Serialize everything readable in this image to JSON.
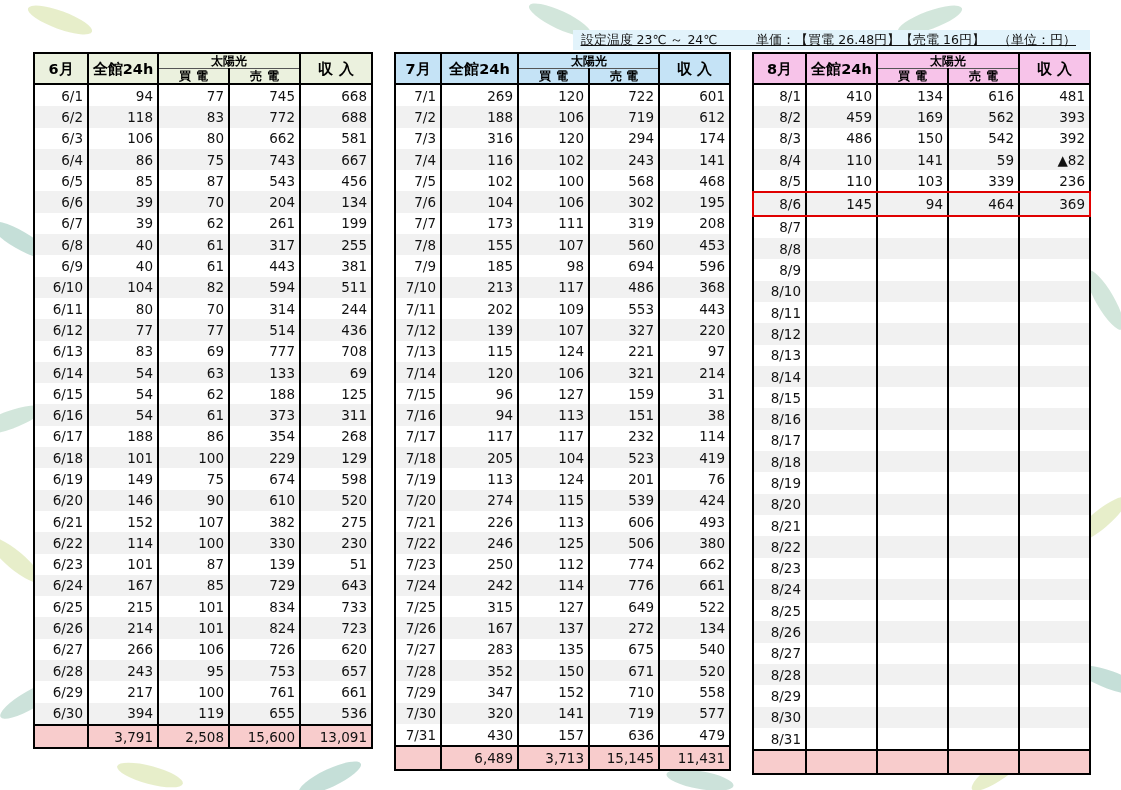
{
  "note": "設定温度 23℃ ～ 24℃　　　単価：【買電 26.48円】【売電 16円】　（単位：円）",
  "tables": [
    {
      "color": "#ebf1de",
      "headers": {
        "month": "6月",
        "total": "全館24h",
        "solar": "太陽光",
        "buy": "買 電",
        "sell": "売 電",
        "income": "収 入"
      },
      "rows": [
        {
          "date": "6/1",
          "values": [
            "94",
            "77",
            "745",
            "668"
          ],
          "highlighted": false
        },
        {
          "date": "6/2",
          "values": [
            "118",
            "83",
            "772",
            "688"
          ],
          "highlighted": false
        },
        {
          "date": "6/3",
          "values": [
            "106",
            "80",
            "662",
            "581"
          ],
          "highlighted": false
        },
        {
          "date": "6/4",
          "values": [
            "86",
            "75",
            "743",
            "667"
          ],
          "highlighted": false
        },
        {
          "date": "6/5",
          "values": [
            "85",
            "87",
            "543",
            "456"
          ],
          "highlighted": false
        },
        {
          "date": "6/6",
          "values": [
            "39",
            "70",
            "204",
            "134"
          ],
          "highlighted": false
        },
        {
          "date": "6/7",
          "values": [
            "39",
            "62",
            "261",
            "199"
          ],
          "highlighted": false
        },
        {
          "date": "6/8",
          "values": [
            "40",
            "61",
            "317",
            "255"
          ],
          "highlighted": false
        },
        {
          "date": "6/9",
          "values": [
            "40",
            "61",
            "443",
            "381"
          ],
          "highlighted": false
        },
        {
          "date": "6/10",
          "values": [
            "104",
            "82",
            "594",
            "511"
          ],
          "highlighted": false
        },
        {
          "date": "6/11",
          "values": [
            "80",
            "70",
            "314",
            "244"
          ],
          "highlighted": false
        },
        {
          "date": "6/12",
          "values": [
            "77",
            "77",
            "514",
            "436"
          ],
          "highlighted": false
        },
        {
          "date": "6/13",
          "values": [
            "83",
            "69",
            "777",
            "708"
          ],
          "highlighted": false
        },
        {
          "date": "6/14",
          "values": [
            "54",
            "63",
            "133",
            "69"
          ],
          "highlighted": false
        },
        {
          "date": "6/15",
          "values": [
            "54",
            "62",
            "188",
            "125"
          ],
          "highlighted": false
        },
        {
          "date": "6/16",
          "values": [
            "54",
            "61",
            "373",
            "311"
          ],
          "highlighted": false
        },
        {
          "date": "6/17",
          "values": [
            "188",
            "86",
            "354",
            "268"
          ],
          "highlighted": false
        },
        {
          "date": "6/18",
          "values": [
            "101",
            "100",
            "229",
            "129"
          ],
          "highlighted": false
        },
        {
          "date": "6/19",
          "values": [
            "149",
            "75",
            "674",
            "598"
          ],
          "highlighted": false
        },
        {
          "date": "6/20",
          "values": [
            "146",
            "90",
            "610",
            "520"
          ],
          "highlighted": false
        },
        {
          "date": "6/21",
          "values": [
            "152",
            "107",
            "382",
            "275"
          ],
          "highlighted": false
        },
        {
          "date": "6/22",
          "values": [
            "114",
            "100",
            "330",
            "230"
          ],
          "highlighted": false
        },
        {
          "date": "6/23",
          "values": [
            "101",
            "87",
            "139",
            "51"
          ],
          "highlighted": false
        },
        {
          "date": "6/24",
          "values": [
            "167",
            "85",
            "729",
            "643"
          ],
          "highlighted": false
        },
        {
          "date": "6/25",
          "values": [
            "215",
            "101",
            "834",
            "733"
          ],
          "highlighted": false
        },
        {
          "date": "6/26",
          "values": [
            "214",
            "101",
            "824",
            "723"
          ],
          "highlighted": false
        },
        {
          "date": "6/27",
          "values": [
            "266",
            "106",
            "726",
            "620"
          ],
          "highlighted": false
        },
        {
          "date": "6/28",
          "values": [
            "243",
            "95",
            "753",
            "657"
          ],
          "highlighted": false
        },
        {
          "date": "6/29",
          "values": [
            "217",
            "100",
            "761",
            "661"
          ],
          "highlighted": false
        },
        {
          "date": "6/30",
          "values": [
            "394",
            "119",
            "655",
            "536"
          ],
          "highlighted": false
        }
      ],
      "totals": [
        "3,791",
        "2,508",
        "15,600",
        "13,091"
      ]
    },
    {
      "color": "#c5e3f6",
      "headers": {
        "month": "7月",
        "total": "全館24h",
        "solar": "太陽光",
        "buy": "買 電",
        "sell": "売 電",
        "income": "収 入"
      },
      "rows": [
        {
          "date": "7/1",
          "values": [
            "269",
            "120",
            "722",
            "601"
          ],
          "highlighted": false
        },
        {
          "date": "7/2",
          "values": [
            "188",
            "106",
            "719",
            "612"
          ],
          "highlighted": false
        },
        {
          "date": "7/3",
          "values": [
            "316",
            "120",
            "294",
            "174"
          ],
          "highlighted": false
        },
        {
          "date": "7/4",
          "values": [
            "116",
            "102",
            "243",
            "141"
          ],
          "highlighted": false
        },
        {
          "date": "7/5",
          "values": [
            "102",
            "100",
            "568",
            "468"
          ],
          "highlighted": false
        },
        {
          "date": "7/6",
          "values": [
            "104",
            "106",
            "302",
            "195"
          ],
          "highlighted": false
        },
        {
          "date": "7/7",
          "values": [
            "173",
            "111",
            "319",
            "208"
          ],
          "highlighted": false
        },
        {
          "date": "7/8",
          "values": [
            "155",
            "107",
            "560",
            "453"
          ],
          "highlighted": false
        },
        {
          "date": "7/9",
          "values": [
            "185",
            "98",
            "694",
            "596"
          ],
          "highlighted": false
        },
        {
          "date": "7/10",
          "values": [
            "213",
            "117",
            "486",
            "368"
          ],
          "highlighted": false
        },
        {
          "date": "7/11",
          "values": [
            "202",
            "109",
            "553",
            "443"
          ],
          "highlighted": false
        },
        {
          "date": "7/12",
          "values": [
            "139",
            "107",
            "327",
            "220"
          ],
          "highlighted": false
        },
        {
          "date": "7/13",
          "values": [
            "115",
            "124",
            "221",
            "97"
          ],
          "highlighted": false
        },
        {
          "date": "7/14",
          "values": [
            "120",
            "106",
            "321",
            "214"
          ],
          "highlighted": false
        },
        {
          "date": "7/15",
          "values": [
            "96",
            "127",
            "159",
            "31"
          ],
          "highlighted": false
        },
        {
          "date": "7/16",
          "values": [
            "94",
            "113",
            "151",
            "38"
          ],
          "highlighted": false
        },
        {
          "date": "7/17",
          "values": [
            "117",
            "117",
            "232",
            "114"
          ],
          "highlighted": false
        },
        {
          "date": "7/18",
          "values": [
            "205",
            "104",
            "523",
            "419"
          ],
          "highlighted": false
        },
        {
          "date": "7/19",
          "values": [
            "113",
            "124",
            "201",
            "76"
          ],
          "highlighted": false
        },
        {
          "date": "7/20",
          "values": [
            "274",
            "115",
            "539",
            "424"
          ],
          "highlighted": false
        },
        {
          "date": "7/21",
          "values": [
            "226",
            "113",
            "606",
            "493"
          ],
          "highlighted": false
        },
        {
          "date": "7/22",
          "values": [
            "246",
            "125",
            "506",
            "380"
          ],
          "highlighted": false
        },
        {
          "date": "7/23",
          "values": [
            "250",
            "112",
            "774",
            "662"
          ],
          "highlighted": false
        },
        {
          "date": "7/24",
          "values": [
            "242",
            "114",
            "776",
            "661"
          ],
          "highlighted": false
        },
        {
          "date": "7/25",
          "values": [
            "315",
            "127",
            "649",
            "522"
          ],
          "highlighted": false
        },
        {
          "date": "7/26",
          "values": [
            "167",
            "137",
            "272",
            "134"
          ],
          "highlighted": false
        },
        {
          "date": "7/27",
          "values": [
            "283",
            "135",
            "675",
            "540"
          ],
          "highlighted": false
        },
        {
          "date": "7/28",
          "values": [
            "352",
            "150",
            "671",
            "520"
          ],
          "highlighted": false
        },
        {
          "date": "7/29",
          "values": [
            "347",
            "152",
            "710",
            "558"
          ],
          "highlighted": false
        },
        {
          "date": "7/30",
          "values": [
            "320",
            "141",
            "719",
            "577"
          ],
          "highlighted": false
        },
        {
          "date": "7/31",
          "values": [
            "430",
            "157",
            "636",
            "479"
          ],
          "highlighted": false
        }
      ],
      "totals": [
        "6,489",
        "3,713",
        "15,145",
        "11,431"
      ]
    },
    {
      "color": "#f7c3e9",
      "headers": {
        "month": "8月",
        "total": "全館24h",
        "solar": "太陽光",
        "buy": "買 電",
        "sell": "売 電",
        "income": "収 入"
      },
      "rows": [
        {
          "date": "8/1",
          "values": [
            "410",
            "134",
            "616",
            "481"
          ],
          "highlighted": false
        },
        {
          "date": "8/2",
          "values": [
            "459",
            "169",
            "562",
            "393"
          ],
          "highlighted": false
        },
        {
          "date": "8/3",
          "values": [
            "486",
            "150",
            "542",
            "392"
          ],
          "highlighted": false
        },
        {
          "date": "8/4",
          "values": [
            "110",
            "141",
            "59",
            "▲82"
          ],
          "highlighted": false
        },
        {
          "date": "8/5",
          "values": [
            "110",
            "103",
            "339",
            "236"
          ],
          "highlighted": false
        },
        {
          "date": "8/6",
          "values": [
            "145",
            "94",
            "464",
            "369"
          ],
          "highlighted": true
        },
        {
          "date": "8/7",
          "highlighted": false
        },
        {
          "date": "8/8",
          "highlighted": false
        },
        {
          "date": "8/9",
          "highlighted": false
        },
        {
          "date": "8/10",
          "highlighted": false
        },
        {
          "date": "8/11",
          "highlighted": false
        },
        {
          "date": "8/12",
          "highlighted": false
        },
        {
          "date": "8/13",
          "highlighted": false
        },
        {
          "date": "8/14",
          "highlighted": false
        },
        {
          "date": "8/15",
          "highlighted": false
        },
        {
          "date": "8/16",
          "highlighted": false
        },
        {
          "date": "8/17",
          "highlighted": false
        },
        {
          "date": "8/18",
          "highlighted": false
        },
        {
          "date": "8/19",
          "highlighted": false
        },
        {
          "date": "8/20",
          "highlighted": false
        },
        {
          "date": "8/21",
          "highlighted": false
        },
        {
          "date": "8/22",
          "highlighted": false
        },
        {
          "date": "8/23",
          "highlighted": false
        },
        {
          "date": "8/24",
          "highlighted": false
        },
        {
          "date": "8/25",
          "highlighted": false
        },
        {
          "date": "8/26",
          "highlighted": false
        },
        {
          "date": "8/27",
          "highlighted": false
        },
        {
          "date": "8/28",
          "highlighted": false
        },
        {
          "date": "8/29",
          "highlighted": false
        },
        {
          "date": "8/30",
          "highlighted": false
        },
        {
          "date": "8/31",
          "highlighted": false
        }
      ]
    }
  ]
}
